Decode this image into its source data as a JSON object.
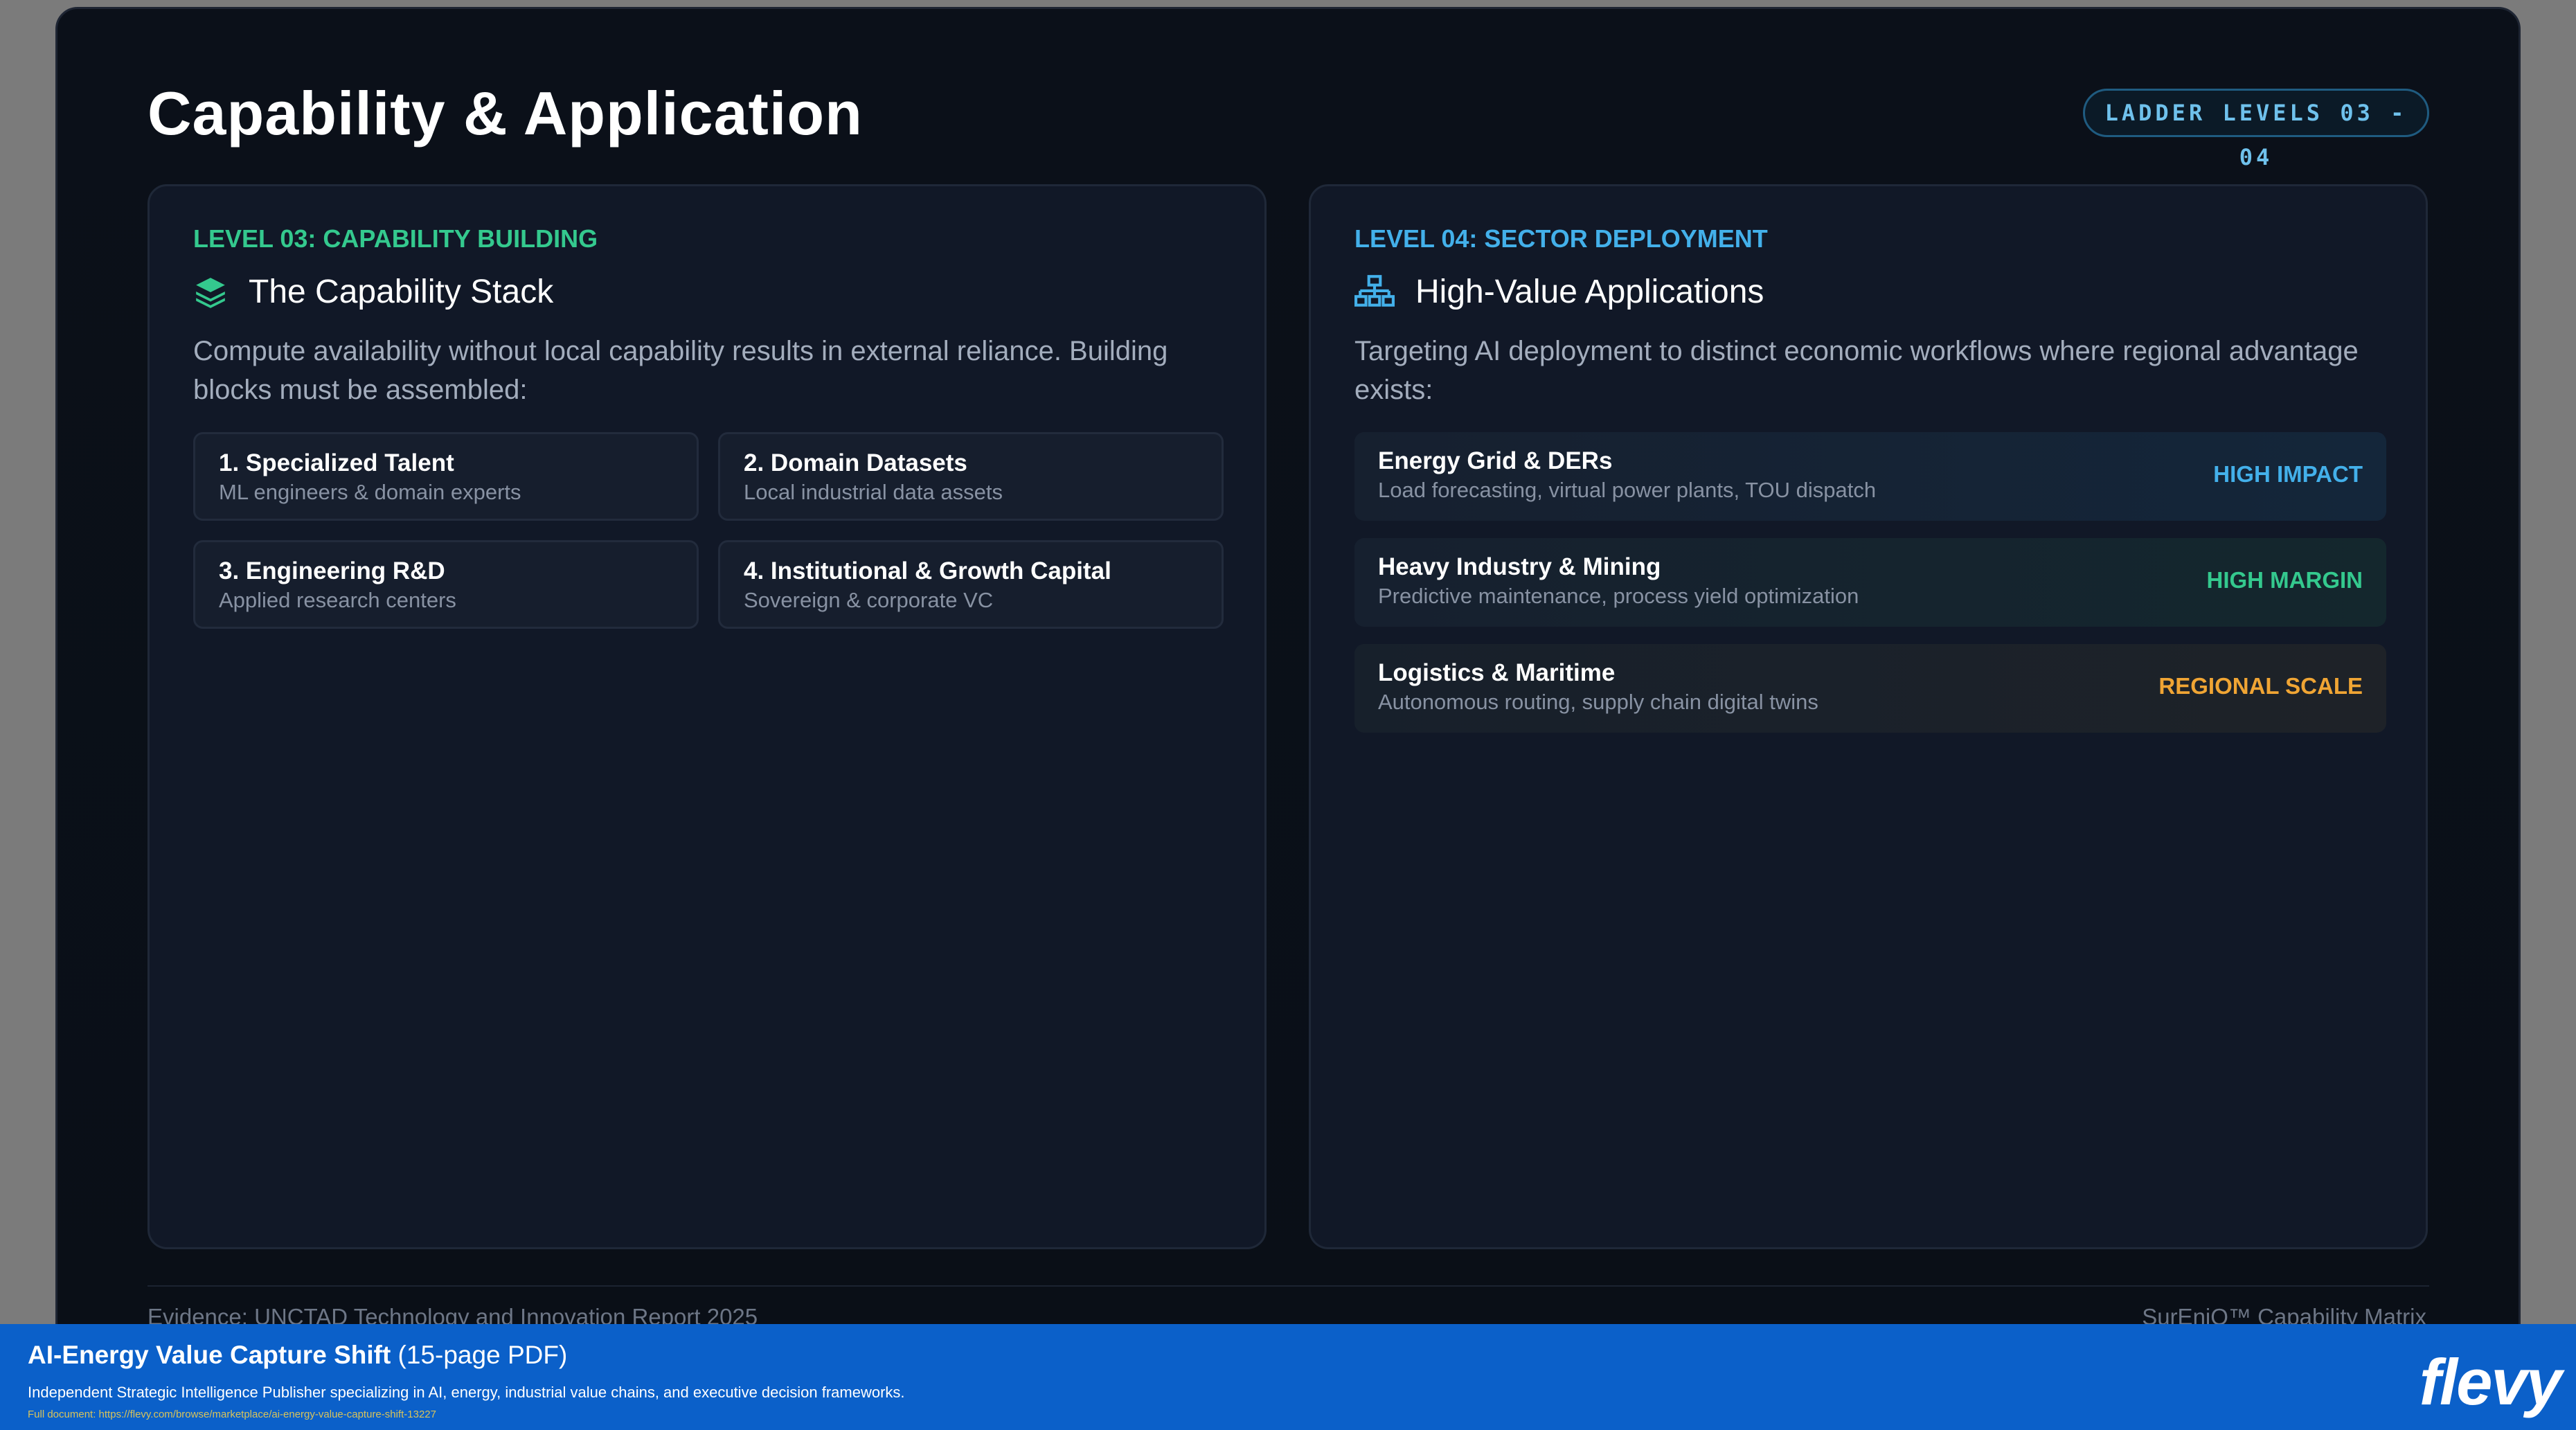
{
  "slide": {
    "title": "Capability & Application",
    "ladder_pill": "LADDER LEVELS 03 - 04"
  },
  "left_panel": {
    "eyebrow": "LEVEL 03: CAPABILITY BUILDING",
    "heading": "The Capability Stack",
    "icon": "layers-icon",
    "description": "Compute availability without local capability results in external reliance. Building blocks must be assembled:",
    "cards": [
      {
        "title": "1. Specialized Talent",
        "subtitle": "ML engineers & domain experts"
      },
      {
        "title": "2. Domain Datasets",
        "subtitle": "Local industrial data assets"
      },
      {
        "title": "3. Engineering R&D",
        "subtitle": "Applied research centers"
      },
      {
        "title": "4. Institutional & Growth Capital",
        "subtitle": "Sovereign & corporate VC"
      }
    ]
  },
  "right_panel": {
    "eyebrow": "LEVEL 04: SECTOR DEPLOYMENT",
    "heading": "High-Value Applications",
    "icon": "network-icon",
    "description": "Targeting AI deployment to distinct economic workflows where regional advantage exists:",
    "applications": [
      {
        "title": "Energy Grid & DERs",
        "subtitle": "Load forecasting, virtual power plants, TOU dispatch",
        "tag": "HIGH IMPACT",
        "tag_color": "#43b0ea"
      },
      {
        "title": "Heavy Industry & Mining",
        "subtitle": "Predictive maintenance, process yield optimization",
        "tag": "HIGH MARGIN",
        "tag_color": "#34c98e"
      },
      {
        "title": "Logistics & Maritime",
        "subtitle": "Autonomous routing, supply chain digital twins",
        "tag": "REGIONAL SCALE",
        "tag_color": "#f0a534"
      }
    ]
  },
  "footer": {
    "evidence": "Evidence: UNCTAD Technology and Innovation Report 2025",
    "matrix": "SurEniQ™ Capability Matrix"
  },
  "banner": {
    "title": "AI-Energy Value Capture Shift",
    "pages": " (15-page PDF)",
    "description": "Independent Strategic Intelligence Publisher specializing in AI, energy, industrial value chains, and executive decision frameworks.",
    "link": "Full document: https://flevy.com/browse/marketplace/ai-energy-value-capture-shift-13227",
    "brand": "flevy"
  },
  "colors": {
    "accent_green": "#34c98e",
    "accent_blue": "#43b0ea",
    "accent_orange": "#f0a534",
    "banner_blue": "#0b60c9"
  }
}
